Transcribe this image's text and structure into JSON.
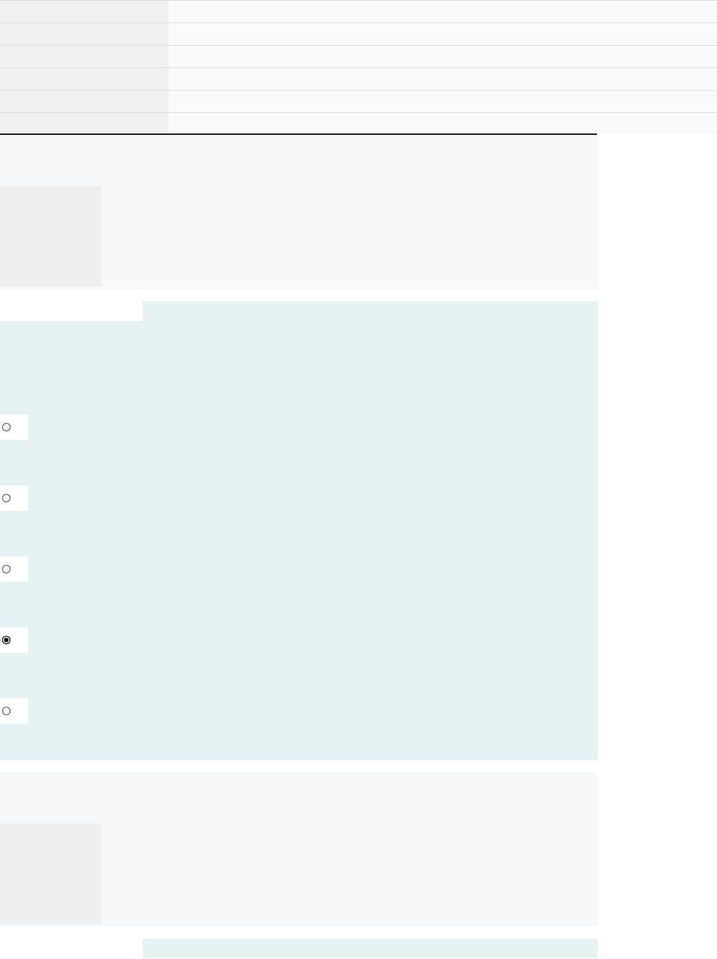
{
  "sections": [
    {
      "kind": "info"
    },
    {
      "kind": "question",
      "options": [
        {
          "selected": false
        },
        {
          "selected": false
        },
        {
          "selected": false
        },
        {
          "selected": true
        },
        {
          "selected": false
        }
      ]
    },
    {
      "kind": "info"
    },
    {
      "kind": "question"
    }
  ]
}
